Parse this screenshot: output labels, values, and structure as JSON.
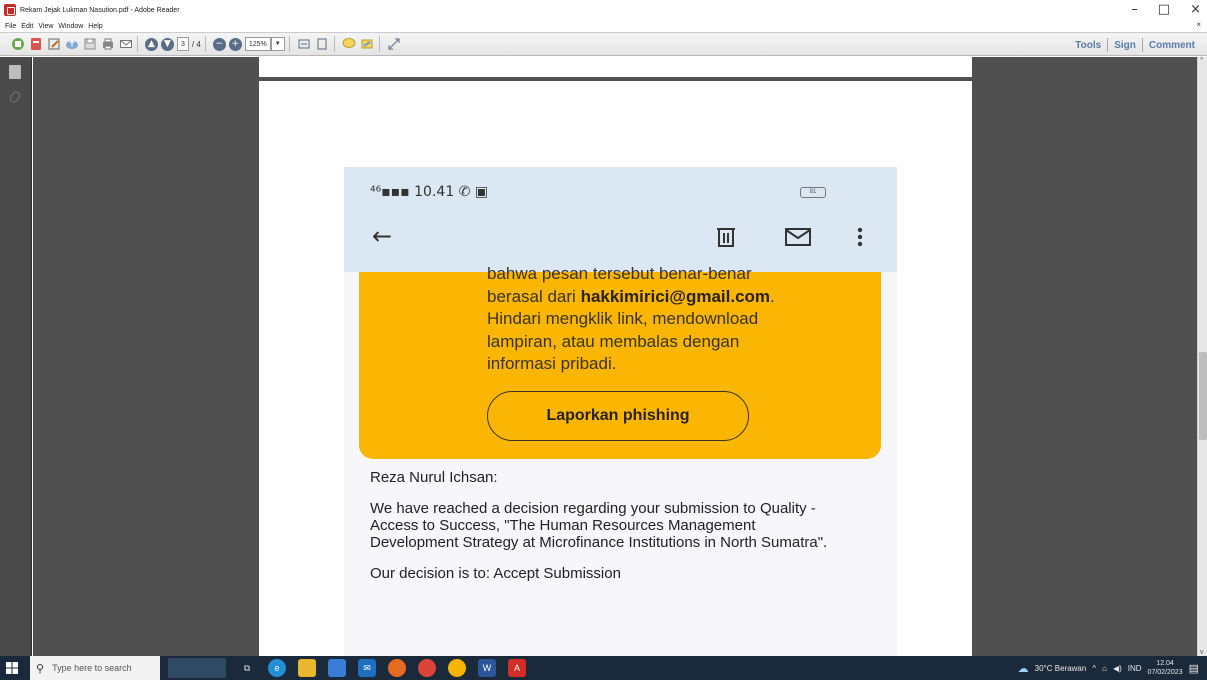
{
  "window": {
    "title": "Rekam Jejak Lukman Nasution.pdf - Adobe Reader",
    "controls": [
      "–",
      "□",
      "×"
    ]
  },
  "menu": [
    "File",
    "Edit",
    "View",
    "Window",
    "Help"
  ],
  "menu_close": "×",
  "toolbar": {
    "page_current": "3",
    "page_total": "/ 4",
    "zoom": "125%",
    "tools_label": "Tools",
    "sign_label": "Sign",
    "comment_label": "Comment"
  },
  "phone": {
    "status_time": "10.41",
    "battery": "81",
    "warning_line1": "bahwa pesan tersebut benar-benar",
    "warning_line2_prefix": "berasal dari ",
    "warning_email": "hakkimirici@gmail.com",
    "warning_line2_suffix": ".",
    "warning_line3": "Hindari mengklik link, mendownload",
    "warning_line4": "lampiran, atau membalas dengan",
    "warning_line5": "informasi pribadi.",
    "report_button": "Laporkan phishing",
    "greeting": "Reza Nurul Ichsan:",
    "body_para": "We have reached a decision regarding your submission to Quality - Access to Success, \"The Human Resources Management Development Strategy at Microfinance Institutions in North Sumatra\".",
    "decision": "Our decision is to: Accept Submission"
  },
  "taskbar": {
    "search_placeholder": "Type here to search",
    "weather": "30°C  Berawan",
    "lang": "IND",
    "time": "12.04",
    "date": "07/02/2023"
  }
}
